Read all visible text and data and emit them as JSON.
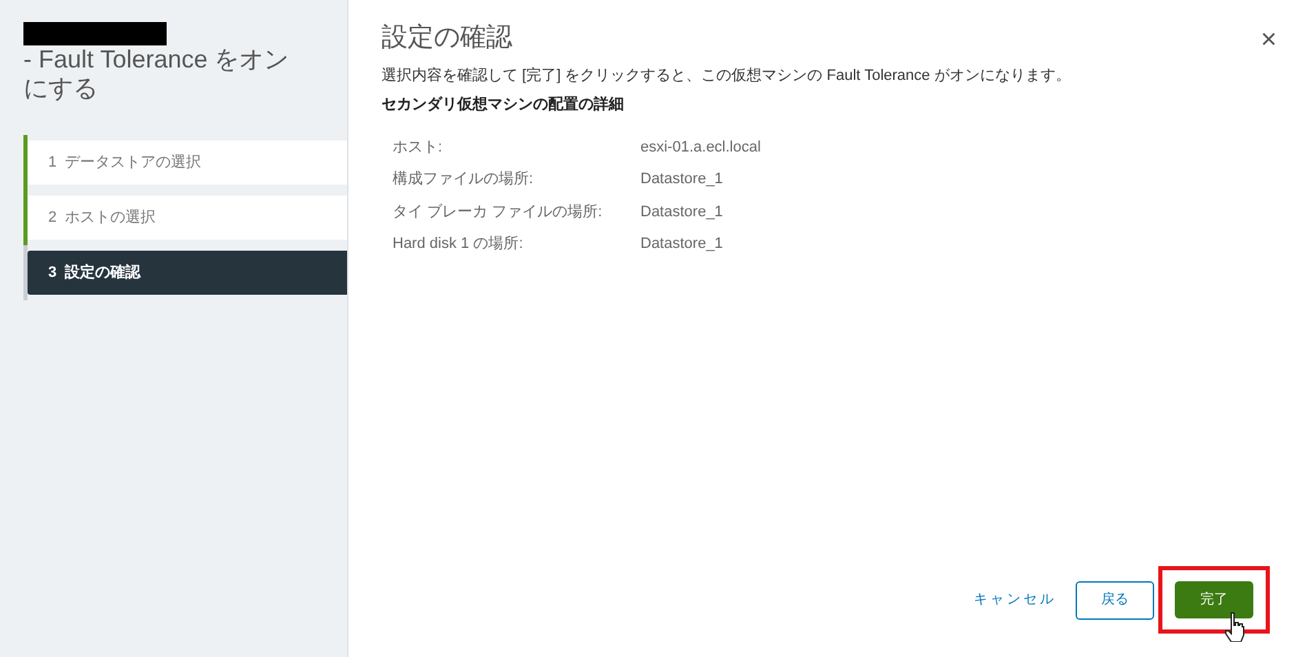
{
  "sidebar": {
    "title": "- Fault Tolerance をオンにする",
    "steps": [
      {
        "number": "1",
        "label": "データストアの選択",
        "completed": true,
        "selected": false
      },
      {
        "number": "2",
        "label": "ホストの選択",
        "completed": true,
        "selected": false
      },
      {
        "number": "3",
        "label": "設定の確認",
        "completed": false,
        "selected": true
      }
    ]
  },
  "main": {
    "title": "設定の確認",
    "close": "×",
    "description": "選択内容を確認して [完了] をクリックすると、この仮想マシンの Fault Tolerance がオンになります。",
    "section_heading": "セカンダリ仮想マシンの配置の詳細",
    "details": [
      {
        "label": "ホスト:",
        "value": "esxi-01.a.ecl.local"
      },
      {
        "label": "構成ファイルの場所:",
        "value": "Datastore_1"
      },
      {
        "label": "タイ ブレーカ ファイルの場所:",
        "value": "Datastore_1"
      },
      {
        "label": "Hard disk 1 の場所:",
        "value": "Datastore_1"
      }
    ]
  },
  "buttons": [
    {
      "label": "キャンセル",
      "kind": "link"
    },
    {
      "label": "戻る",
      "kind": "outline"
    },
    {
      "label": "完了",
      "kind": "primary"
    }
  ]
}
